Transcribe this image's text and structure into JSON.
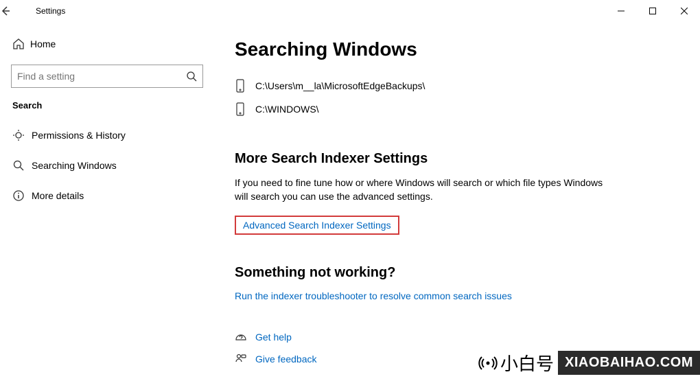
{
  "window": {
    "title": "Settings"
  },
  "sidebar": {
    "home": "Home",
    "search_placeholder": "Find a setting",
    "section": "Search",
    "items": [
      {
        "label": "Permissions & History"
      },
      {
        "label": "Searching Windows"
      },
      {
        "label": "More details"
      }
    ]
  },
  "content": {
    "title": "Searching Windows",
    "folders": [
      "C:\\Users\\m__la\\MicrosoftEdgeBackups\\",
      "C:\\WINDOWS\\"
    ],
    "indexer": {
      "heading": "More Search Indexer Settings",
      "desc": "If you need to fine tune how or where Windows will search or which file types Windows will search you can use the advanced settings.",
      "link": "Advanced Search Indexer Settings"
    },
    "troubleshoot": {
      "heading": "Something not working?",
      "link": "Run the indexer troubleshooter to resolve common search issues"
    },
    "help": {
      "get_help": "Get help",
      "feedback": "Give feedback"
    }
  },
  "watermark": {
    "brand_cn": "小白号",
    "brand_en": "XIAOBAIHAO.COM"
  }
}
